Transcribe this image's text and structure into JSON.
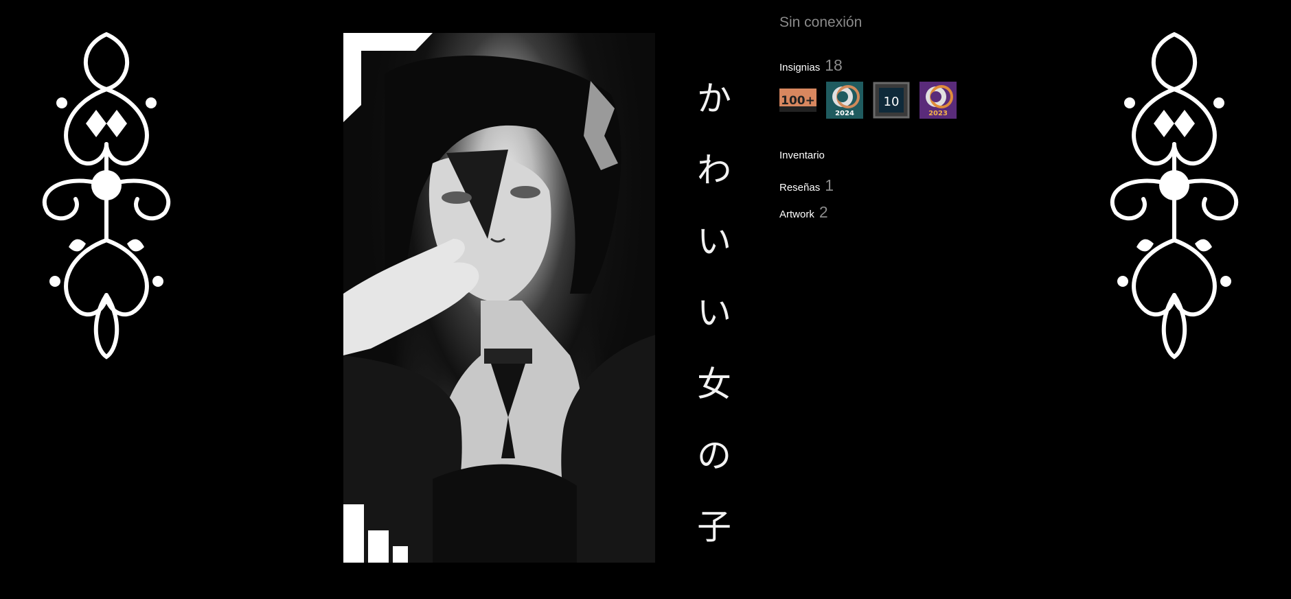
{
  "profile": {
    "status": "Sin conexión",
    "badges_label": "Insignias",
    "badges_count": "18",
    "badges": [
      {
        "name": "100+",
        "icon": "years-100-badge-icon"
      },
      {
        "name": "2024",
        "icon": "steam-2024-badge-icon"
      },
      {
        "name": "10",
        "icon": "level-10-badge-icon"
      },
      {
        "name": "2023",
        "icon": "steam-2023-badge-icon"
      }
    ],
    "links": [
      {
        "label": "Inventario",
        "count": ""
      },
      {
        "label": "Reseñas",
        "count": "1"
      },
      {
        "label": "Artwork",
        "count": "2"
      }
    ]
  },
  "showcase": {
    "vertical_title": [
      "か",
      "わ",
      "い",
      "い",
      "女",
      "の",
      "子"
    ]
  },
  "colors": {
    "background": "#000000",
    "text_primary": "#ffffff",
    "text_muted": "#8b8b8b",
    "badge_2024_bg": "#1f5b5f",
    "badge_2023_bg": "#5a2b7a",
    "badge_2023_ring": "#e08c3a",
    "badge_100_bg": "#d8875f"
  }
}
